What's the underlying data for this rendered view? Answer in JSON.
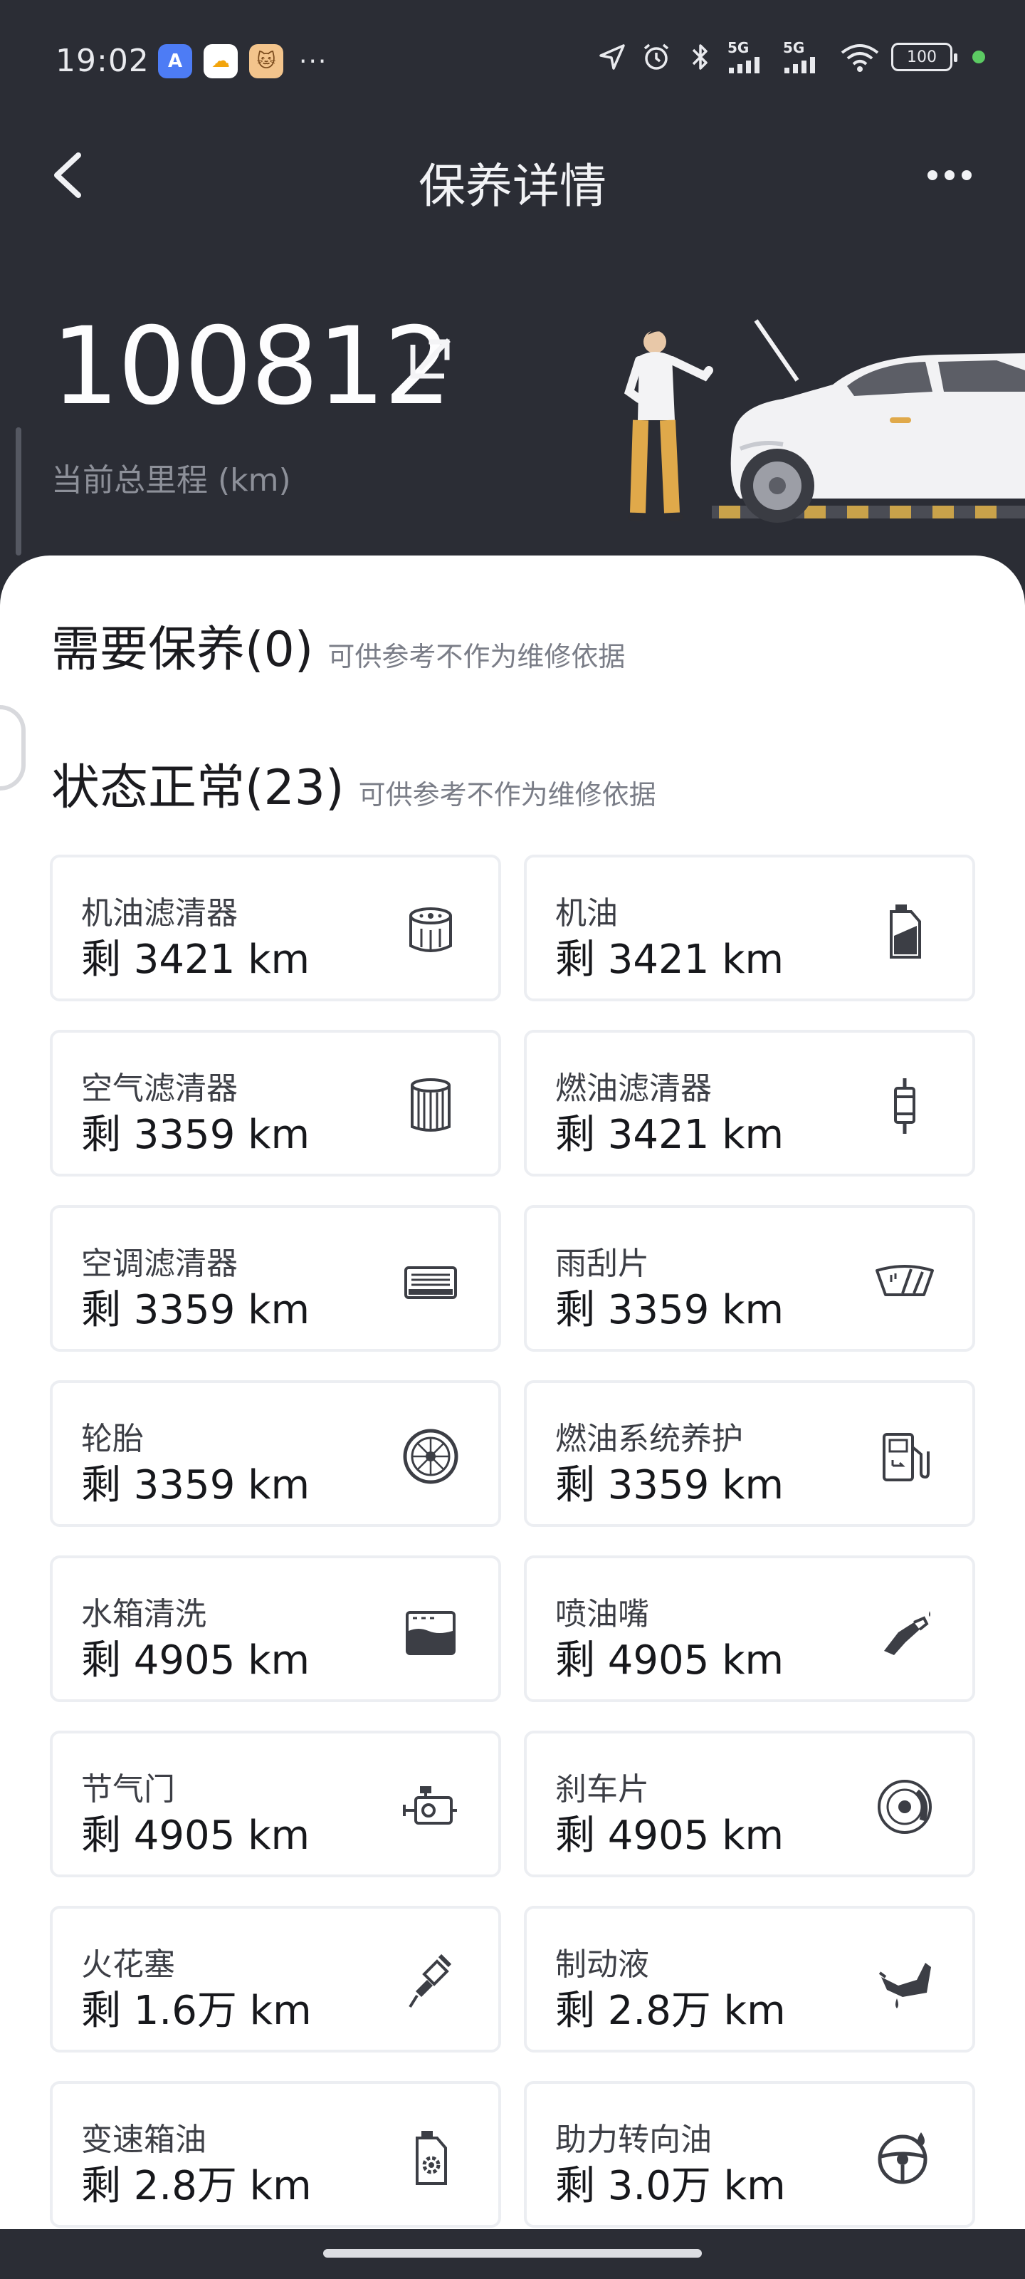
{
  "status_bar": {
    "time": "19:02",
    "apps": [
      "A",
      "☁",
      "🐱"
    ],
    "more": "···",
    "net1": "5G",
    "net2": "5G",
    "battery": "100"
  },
  "nav": {
    "title": "保养详情"
  },
  "hero": {
    "mileage": "100812",
    "mileage_label": "当前总里程 (km)"
  },
  "sections": {
    "need": {
      "title": "需要保养(0)",
      "note": "可供参考不作为维修依据"
    },
    "normal": {
      "title": "状态正常(23)",
      "note": "可供参考不作为维修依据"
    }
  },
  "items": [
    {
      "name": "机油滤清器",
      "remain": "剩 3421 km",
      "icon": "oil-filter-icon"
    },
    {
      "name": "机油",
      "remain": "剩 3421 km",
      "icon": "oil-can-icon"
    },
    {
      "name": "空气滤清器",
      "remain": "剩 3359 km",
      "icon": "air-filter-icon"
    },
    {
      "name": "燃油滤清器",
      "remain": "剩 3421 km",
      "icon": "fuel-filter-icon"
    },
    {
      "name": "空调滤清器",
      "remain": "剩 3359 km",
      "icon": "ac-filter-icon"
    },
    {
      "name": "雨刮片",
      "remain": "剩 3359 km",
      "icon": "wiper-icon"
    },
    {
      "name": "轮胎",
      "remain": "剩 3359 km",
      "icon": "tire-icon"
    },
    {
      "name": "燃油系统养护",
      "remain": "剩 3359 km",
      "icon": "fuel-pump-icon"
    },
    {
      "name": "水箱清洗",
      "remain": "剩 4905 km",
      "icon": "radiator-icon"
    },
    {
      "name": "喷油嘴",
      "remain": "剩 4905 km",
      "icon": "injector-icon"
    },
    {
      "name": "节气门",
      "remain": "剩 4905 km",
      "icon": "throttle-icon"
    },
    {
      "name": "刹车片",
      "remain": "剩 4905 km",
      "icon": "brake-disc-icon"
    },
    {
      "name": "火花塞",
      "remain": "剩 1.6万 km",
      "icon": "spark-plug-icon"
    },
    {
      "name": "制动液",
      "remain": "剩 2.8万 km",
      "icon": "brake-fluid-icon"
    },
    {
      "name": "变速箱油",
      "remain": "剩 2.8万 km",
      "icon": "gear-oil-icon"
    },
    {
      "name": "助力转向油",
      "remain": "剩 3.0万 km",
      "icon": "steering-oil-icon"
    }
  ]
}
